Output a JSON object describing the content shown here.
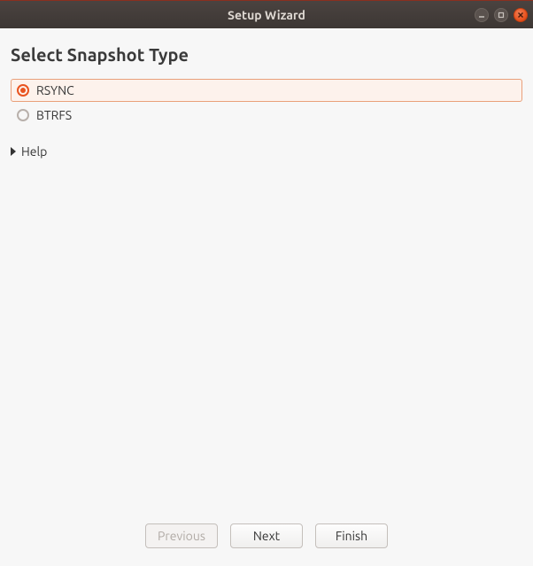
{
  "window": {
    "title": "Setup Wizard"
  },
  "page": {
    "heading": "Select Snapshot Type"
  },
  "options": {
    "rsync": {
      "label": "RSYNC",
      "selected": true
    },
    "btrfs": {
      "label": "BTRFS",
      "selected": false
    }
  },
  "help": {
    "label": "Help"
  },
  "footer": {
    "previous": "Previous",
    "next": "Next",
    "finish": "Finish"
  }
}
